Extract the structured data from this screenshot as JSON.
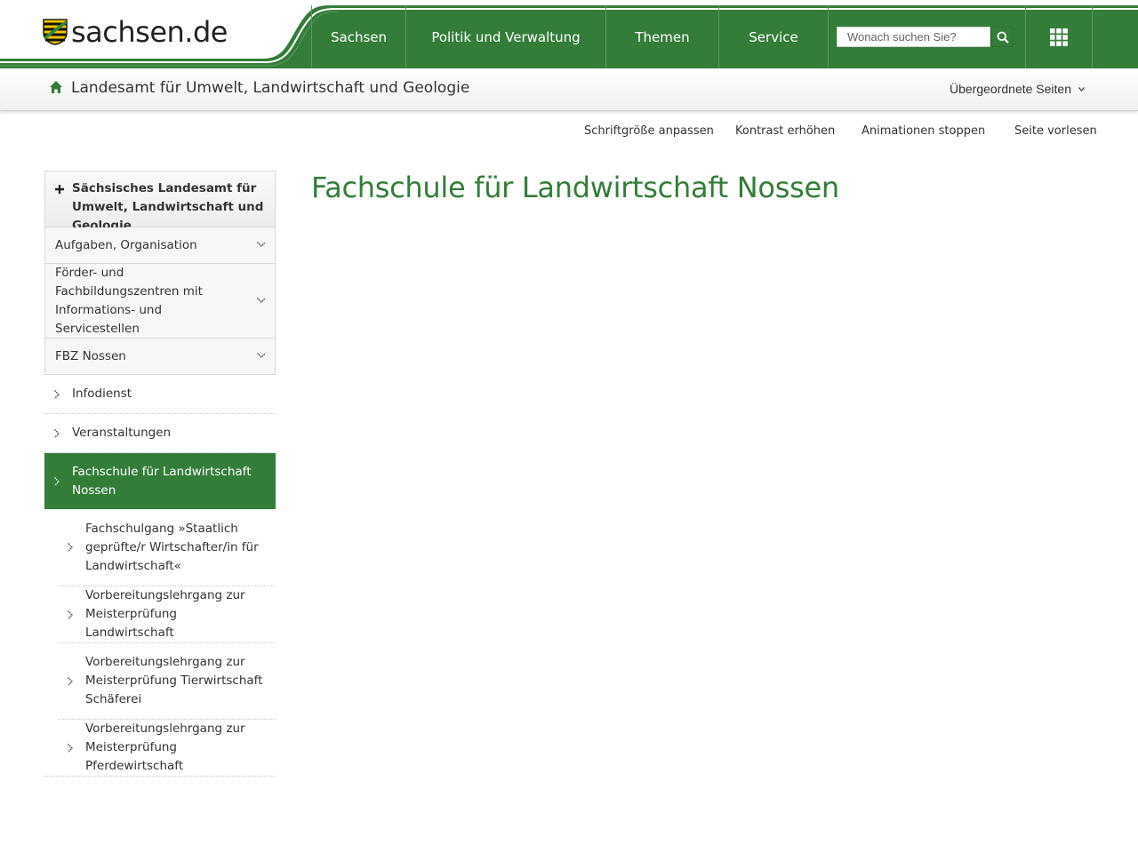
{
  "header": {
    "logo_text": "sachsen.de",
    "nav": [
      {
        "label": "Sachsen"
      },
      {
        "label": "Politik und Verwaltung"
      },
      {
        "label": "Themen"
      },
      {
        "label": "Service"
      }
    ],
    "search": {
      "placeholder": "Wonach suchen Sie?"
    },
    "colors": {
      "brand_green": "#347d39",
      "dark_green": "#2b7032"
    }
  },
  "subheader": {
    "title": "Landesamt für Umwelt, Landwirtschaft und Geologie",
    "parent_pages_label": "Übergeordnete Seiten"
  },
  "accessibility": [
    {
      "label": "Schriftgröße anpassen"
    },
    {
      "label": "Kontrast erhöhen"
    },
    {
      "label": "Animationen stoppen"
    },
    {
      "label": "Seite vorlesen"
    }
  ],
  "sidebar": {
    "root": "Sächsisches Landesamt für Umwelt, Landwirtschaft und Geologie",
    "parents": [
      {
        "label": "Aufgaben, Organisation"
      },
      {
        "label": "Förder- und Fachbildungszentren mit Informations- und Servicestellen"
      },
      {
        "label": "FBZ Nossen"
      }
    ],
    "items": [
      {
        "label": "Infodienst"
      },
      {
        "label": "Veranstaltungen"
      },
      {
        "label": "Fachschule für Landwirtschaft Nossen"
      }
    ],
    "subitems": [
      {
        "label": "Fachschulgang »Staatlich geprüfte/r Wirtschafter/in für Landwirtschaft«"
      },
      {
        "label": "Vorbereitungslehrgang zur Meisterprüfung Landwirtschaft"
      },
      {
        "label": "Vorbereitungslehrgang zur Meisterprüfung Tierwirtschaft Schäferei"
      },
      {
        "label": "Vorbereitungslehrgang zur Meisterprüfung Pferdewirtschaft"
      }
    ]
  },
  "main": {
    "title": "Fachschule für Landwirtschaft Nossen"
  }
}
